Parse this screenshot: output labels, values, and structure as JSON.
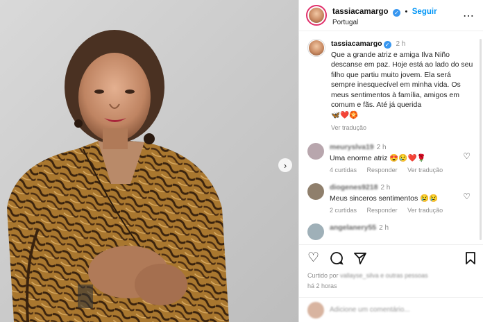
{
  "header": {
    "username": "tassiacamargo",
    "follow_label": "Seguir",
    "location": "Portugal"
  },
  "caption": {
    "username": "tassiacamargo",
    "time": "2 h",
    "text": "Que a grande atriz e amiga Ilva Niño descanse em paz. Hoje está ao lado do seu filho que partiu muito jovem. Ela será sempre inesquecível em minha vida. Os meus sentimentos à família, amigos em comum e fãs. Até já querida",
    "emojis": "🦋❤️🏵️",
    "translate_label": "Ver tradução"
  },
  "comments": [
    {
      "user": "meuryslva19",
      "time": "2 h",
      "text": "Uma enorme atriz 😍😢❤️🌹",
      "likes": "4 curtidas",
      "reply": "Responder",
      "translate": "Ver tradução",
      "avatar_color": "#b8a6ad"
    },
    {
      "user": "diogenes9218",
      "time": "2 h",
      "text": "Meus sinceros sentimentos 😢😢",
      "likes": "2 curtidas",
      "reply": "Responder",
      "translate": "Ver tradução",
      "avatar_color": "#8f7f6c"
    },
    {
      "user": "angelanery55",
      "time": "2 h",
      "text": "",
      "likes": "",
      "reply": "",
      "translate": "",
      "avatar_color": "#9fb0b8"
    }
  ],
  "actions": {
    "like_icon": "heart-icon",
    "comment_icon": "comment-icon",
    "share_icon": "share-icon",
    "save_icon": "bookmark-icon"
  },
  "liked_by": {
    "prefix": "Curtido por",
    "names": "vallayse_silva e outras pessoas"
  },
  "posted_ago": "há 2 horas",
  "add_comment_placeholder": "Adicione um comentário...",
  "colors": {
    "follow": "#0095f6",
    "verified": "#3897f0"
  }
}
